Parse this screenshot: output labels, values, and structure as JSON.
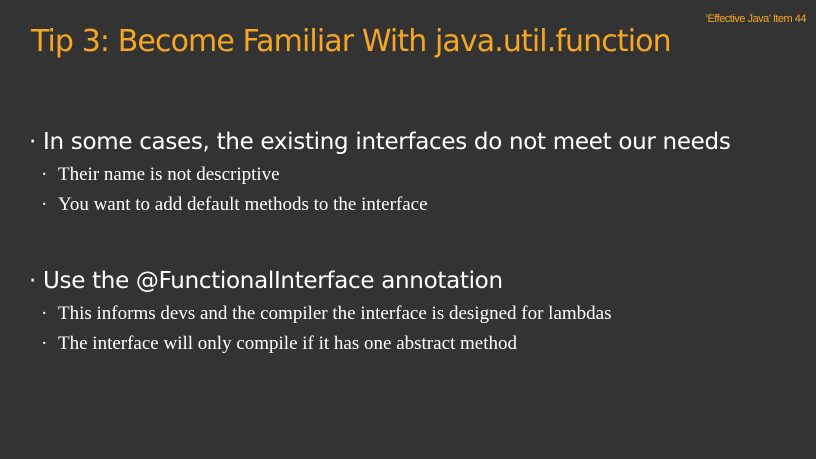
{
  "slide": {
    "reference": "‘Effective Java’ Item 44",
    "title": "Tip 3: Become Familiar With java.util.function",
    "bullet_marker": "·",
    "groups": [
      {
        "text": "In some cases, the existing interfaces do not meet our needs",
        "subs": [
          "Their name is not descriptive",
          "You want to add default methods to the interface"
        ]
      },
      {
        "text": "Use the @FunctionalInterface annotation",
        "subs": [
          "This informs devs and the compiler the interface is designed for lambdas",
          "The interface will only compile if it has one abstract method"
        ]
      }
    ]
  },
  "colors": {
    "background": "#333333",
    "accent": "#f5a623",
    "text": "#ffffff"
  }
}
